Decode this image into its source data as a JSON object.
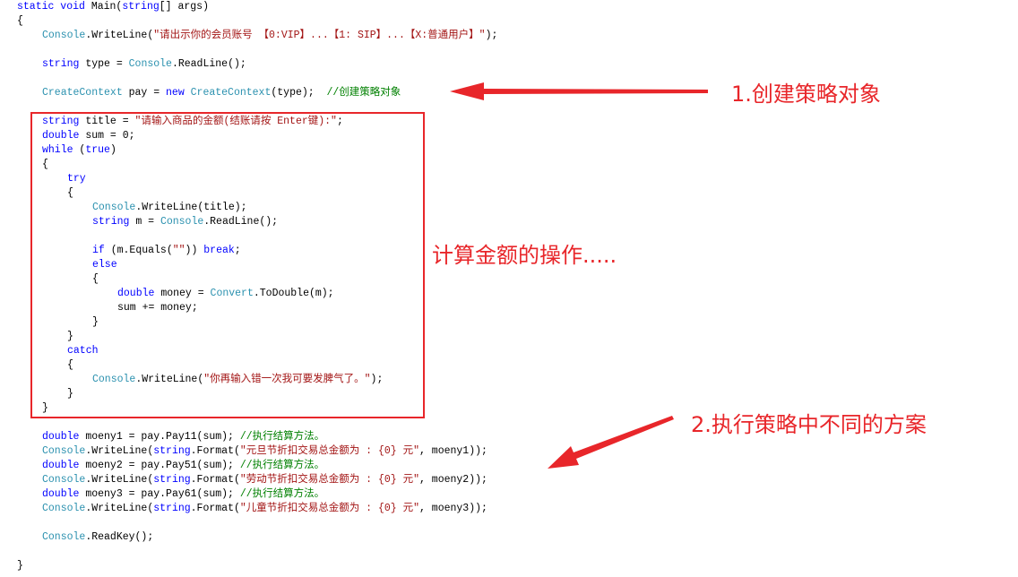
{
  "colors": {
    "keyword": "#0000ff",
    "type": "#2b91af",
    "string": "#a31515",
    "comment": "#008000",
    "annotation": "#e8262a"
  },
  "code": [
    {
      "indent": 0,
      "tokens": [
        [
          "kw",
          "static void "
        ],
        [
          "pl",
          "Main("
        ],
        [
          "kw",
          "string"
        ],
        [
          "pl",
          "[] args)"
        ]
      ]
    },
    {
      "indent": 0,
      "tokens": [
        [
          "pl",
          "{"
        ]
      ]
    },
    {
      "indent": 1,
      "tokens": [
        [
          "ty",
          "Console"
        ],
        [
          "pl",
          ".WriteLine("
        ],
        [
          "st",
          "\"请出示你的会员账号 【0:VIP】...【1: SIP】...【X:普通用户】\""
        ],
        [
          "pl",
          ");"
        ]
      ]
    },
    {
      "indent": 0,
      "tokens": []
    },
    {
      "indent": 1,
      "tokens": [
        [
          "kw",
          "string"
        ],
        [
          "pl",
          " type = "
        ],
        [
          "ty",
          "Console"
        ],
        [
          "pl",
          ".ReadLine();"
        ]
      ]
    },
    {
      "indent": 0,
      "tokens": []
    },
    {
      "indent": 1,
      "tokens": [
        [
          "ty",
          "CreateContext"
        ],
        [
          "pl",
          " pay = "
        ],
        [
          "kw",
          "new "
        ],
        [
          "ty",
          "CreateContext"
        ],
        [
          "pl",
          "(type);  "
        ],
        [
          "cm",
          "//创建策略对象"
        ]
      ]
    },
    {
      "indent": 0,
      "tokens": []
    },
    {
      "indent": 1,
      "tokens": [
        [
          "kw",
          "string"
        ],
        [
          "pl",
          " title = "
        ],
        [
          "st",
          "\"请输入商品的金额(结账请按 Enter键):\""
        ],
        [
          "pl",
          ";"
        ]
      ]
    },
    {
      "indent": 1,
      "tokens": [
        [
          "kw",
          "double"
        ],
        [
          "pl",
          " sum = 0;"
        ]
      ]
    },
    {
      "indent": 1,
      "tokens": [
        [
          "kw",
          "while"
        ],
        [
          "pl",
          " ("
        ],
        [
          "kw",
          "true"
        ],
        [
          "pl",
          ")"
        ]
      ]
    },
    {
      "indent": 1,
      "tokens": [
        [
          "pl",
          "{"
        ]
      ]
    },
    {
      "indent": 2,
      "tokens": [
        [
          "kw",
          "try"
        ]
      ]
    },
    {
      "indent": 2,
      "tokens": [
        [
          "pl",
          "{"
        ]
      ]
    },
    {
      "indent": 3,
      "tokens": [
        [
          "ty",
          "Console"
        ],
        [
          "pl",
          ".WriteLine(title);"
        ]
      ]
    },
    {
      "indent": 3,
      "tokens": [
        [
          "kw",
          "string"
        ],
        [
          "pl",
          " m = "
        ],
        [
          "ty",
          "Console"
        ],
        [
          "pl",
          ".ReadLine();"
        ]
      ]
    },
    {
      "indent": 0,
      "tokens": []
    },
    {
      "indent": 3,
      "tokens": [
        [
          "kw",
          "if"
        ],
        [
          "pl",
          " (m.Equals("
        ],
        [
          "st",
          "\"\""
        ],
        [
          "pl",
          ")) "
        ],
        [
          "kw",
          "break"
        ],
        [
          "pl",
          ";"
        ]
      ]
    },
    {
      "indent": 3,
      "tokens": [
        [
          "kw",
          "else"
        ]
      ]
    },
    {
      "indent": 3,
      "tokens": [
        [
          "pl",
          "{"
        ]
      ]
    },
    {
      "indent": 4,
      "tokens": [
        [
          "kw",
          "double"
        ],
        [
          "pl",
          " money = "
        ],
        [
          "ty",
          "Convert"
        ],
        [
          "pl",
          ".ToDouble(m);"
        ]
      ]
    },
    {
      "indent": 4,
      "tokens": [
        [
          "pl",
          "sum += money;"
        ]
      ]
    },
    {
      "indent": 3,
      "tokens": [
        [
          "pl",
          "}"
        ]
      ]
    },
    {
      "indent": 2,
      "tokens": [
        [
          "pl",
          "}"
        ]
      ]
    },
    {
      "indent": 2,
      "tokens": [
        [
          "kw",
          "catch"
        ]
      ]
    },
    {
      "indent": 2,
      "tokens": [
        [
          "pl",
          "{"
        ]
      ]
    },
    {
      "indent": 3,
      "tokens": [
        [
          "ty",
          "Console"
        ],
        [
          "pl",
          ".WriteLine("
        ],
        [
          "st",
          "\"你再输入错一次我可要发脾气了。\""
        ],
        [
          "pl",
          ");"
        ]
      ]
    },
    {
      "indent": 2,
      "tokens": [
        [
          "pl",
          "}"
        ]
      ]
    },
    {
      "indent": 1,
      "tokens": [
        [
          "pl",
          "}"
        ]
      ]
    },
    {
      "indent": 0,
      "tokens": []
    },
    {
      "indent": 1,
      "tokens": [
        [
          "kw",
          "double"
        ],
        [
          "pl",
          " moeny1 = pay.Pay11(sum); "
        ],
        [
          "cm",
          "//执行结算方法。"
        ]
      ]
    },
    {
      "indent": 1,
      "tokens": [
        [
          "ty",
          "Console"
        ],
        [
          "pl",
          ".WriteLine("
        ],
        [
          "kw",
          "string"
        ],
        [
          "pl",
          ".Format("
        ],
        [
          "st",
          "\"元旦节折扣交易总金额为 : {0} 元\""
        ],
        [
          "pl",
          ", moeny1));"
        ]
      ]
    },
    {
      "indent": 1,
      "tokens": [
        [
          "kw",
          "double"
        ],
        [
          "pl",
          " moeny2 = pay.Pay51(sum); "
        ],
        [
          "cm",
          "//执行结算方法。"
        ]
      ]
    },
    {
      "indent": 1,
      "tokens": [
        [
          "ty",
          "Console"
        ],
        [
          "pl",
          ".WriteLine("
        ],
        [
          "kw",
          "string"
        ],
        [
          "pl",
          ".Format("
        ],
        [
          "st",
          "\"劳动节折扣交易总金额为 : {0} 元\""
        ],
        [
          "pl",
          ", moeny2));"
        ]
      ]
    },
    {
      "indent": 1,
      "tokens": [
        [
          "kw",
          "double"
        ],
        [
          "pl",
          " moeny3 = pay.Pay61(sum); "
        ],
        [
          "cm",
          "//执行结算方法。"
        ]
      ]
    },
    {
      "indent": 1,
      "tokens": [
        [
          "ty",
          "Console"
        ],
        [
          "pl",
          ".WriteLine("
        ],
        [
          "kw",
          "string"
        ],
        [
          "pl",
          ".Format("
        ],
        [
          "st",
          "\"儿童节折扣交易总金额为 : {0} 元\""
        ],
        [
          "pl",
          ", moeny3));"
        ]
      ]
    },
    {
      "indent": 0,
      "tokens": []
    },
    {
      "indent": 1,
      "tokens": [
        [
          "ty",
          "Console"
        ],
        [
          "pl",
          ".ReadKey();"
        ]
      ]
    },
    {
      "indent": 0,
      "tokens": []
    },
    {
      "indent": 0,
      "tokens": [
        [
          "pl",
          "}"
        ]
      ]
    }
  ],
  "annotations": {
    "step1": "1.创建策略对象",
    "calc": "计算金额的操作.....",
    "step2": "2.执行策略中不同的方案"
  }
}
